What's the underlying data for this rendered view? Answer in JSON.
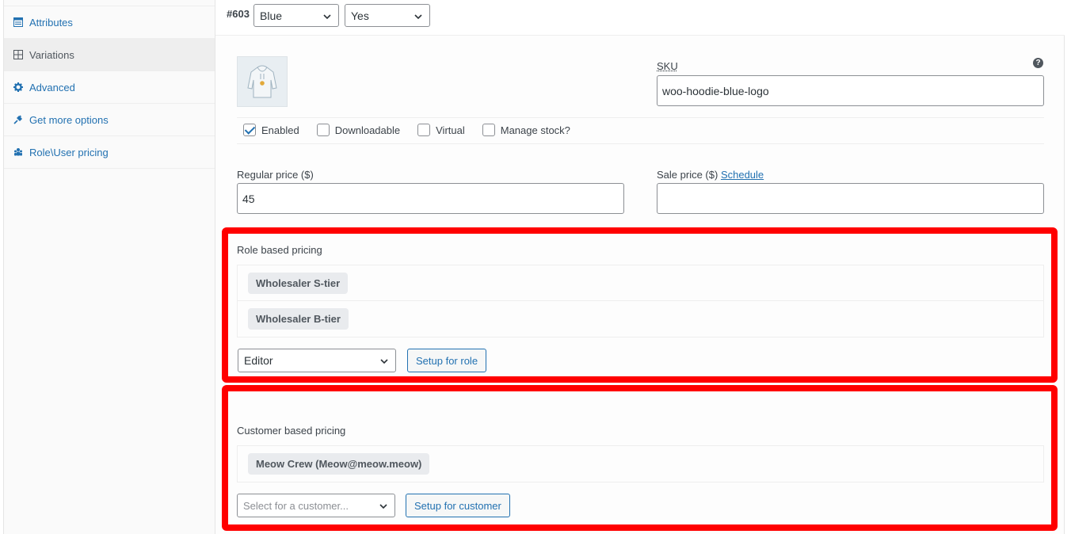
{
  "sidebar": {
    "items": [
      {
        "label": "Attributes",
        "icon": "table-icon"
      },
      {
        "label": "Variations",
        "icon": "grid-icon"
      },
      {
        "label": "Advanced",
        "icon": "gear-icon"
      },
      {
        "label": "Get more options",
        "icon": "plugin-icon"
      },
      {
        "label": "Role\\User pricing",
        "icon": "group-icon"
      }
    ],
    "active": "Variations"
  },
  "variation": {
    "id": "#603",
    "attr1": "Blue",
    "attr2": "Yes"
  },
  "sku": {
    "label": "SKU",
    "value": "woo-hoodie-blue-logo",
    "help": "?"
  },
  "options": {
    "enabled": {
      "label": "Enabled",
      "checked": true
    },
    "downloadable": {
      "label": "Downloadable",
      "checked": false
    },
    "virtual": {
      "label": "Virtual",
      "checked": false
    },
    "manage_stock": {
      "label": "Manage stock?",
      "checked": false
    }
  },
  "pricing": {
    "regular_label": "Regular price ($)",
    "regular_value": "45",
    "sale_label": "Sale price ($)",
    "schedule_link": "Schedule",
    "sale_value": ""
  },
  "role_pricing": {
    "title": "Role based pricing",
    "roles": [
      "Wholesaler S-tier",
      "Wholesaler B-tier"
    ],
    "role_select": "Editor",
    "setup_button": "Setup for role"
  },
  "customer_pricing": {
    "title": "Customer based pricing",
    "customers": [
      "Meow Crew (Meow@meow.meow)"
    ],
    "customer_placeholder": "Select for a customer...",
    "setup_button": "Setup for customer"
  },
  "colors": {
    "accent": "#2271b1",
    "highlight_border": "#ff0000"
  }
}
